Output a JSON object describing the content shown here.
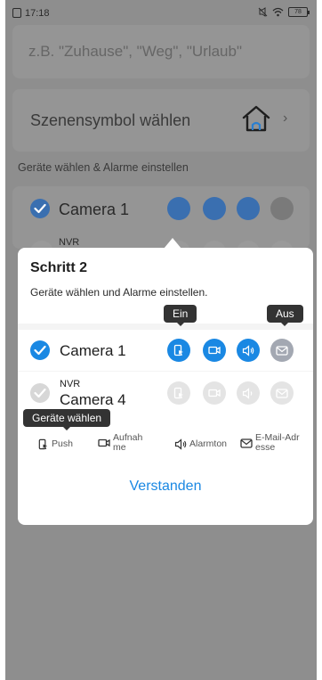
{
  "status_bar": {
    "time": "17:18",
    "battery": "78"
  },
  "background": {
    "name_placeholder": "z.B. \"Zuhause\", \"Weg\", \"Urlaub\"",
    "symbol_label": "Szenensymbol wählen",
    "section_label": "Geräte wählen & Alarme einstellen",
    "device1": "Camera 1",
    "device2_group": "NVR"
  },
  "dialog": {
    "title": "Schritt 2",
    "subtitle": "Geräte wählen und Alarme einstellen.",
    "tooltip_on": "Ein",
    "tooltip_off": "Aus",
    "tooltip_select": "Geräte wählen",
    "rows": [
      {
        "name": "Camera 1",
        "group": "",
        "checked": true,
        "push": "on",
        "record": "on",
        "alarm": "on",
        "email": "off"
      },
      {
        "name": "Camera 4",
        "group": "NVR",
        "checked": false,
        "push": "disabled",
        "record": "disabled",
        "alarm": "disabled",
        "email": "disabled"
      }
    ],
    "legend": {
      "push": "Push",
      "record": "Aufnahme",
      "alarm": "Alarmton",
      "email": "E-Mail-Adresse"
    },
    "confirm_label": "Verstanden"
  },
  "icons": {
    "push": "push-phone-icon",
    "record": "video-camera-icon",
    "alarm": "speaker-icon",
    "email": "envelope-icon",
    "symbol": "house-icon"
  },
  "colors": {
    "accent": "#1a88e3",
    "tooltip": "#333333",
    "email_off": "#a3a8b2"
  }
}
